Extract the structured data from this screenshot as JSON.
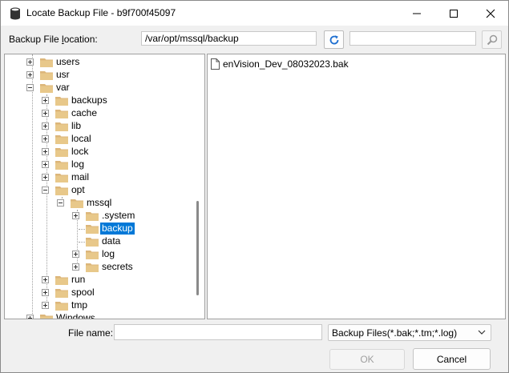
{
  "window": {
    "title": "Locate Backup File - b9f700f45097",
    "minimize_icon": "minimize-icon",
    "maximize_icon": "maximize-icon",
    "close_icon": "close-icon"
  },
  "location": {
    "label_pre": "Backup File ",
    "label_u": "l",
    "label_post": "ocation:",
    "path_value": "/var/opt/mssql/backup",
    "search_value": "",
    "refresh_icon": "refresh-icon",
    "search_icon": "search-icon"
  },
  "tree": {
    "items": [
      {
        "label": "users",
        "expander": "plus"
      },
      {
        "label": "usr",
        "expander": "plus"
      },
      {
        "label": "var",
        "expander": "minus"
      },
      {
        "label": "backups",
        "expander": "plus"
      },
      {
        "label": "cache",
        "expander": "plus"
      },
      {
        "label": "lib",
        "expander": "plus"
      },
      {
        "label": "local",
        "expander": "plus"
      },
      {
        "label": "lock",
        "expander": "plus"
      },
      {
        "label": "log",
        "expander": "plus"
      },
      {
        "label": "mail",
        "expander": "plus"
      },
      {
        "label": "opt",
        "expander": "minus"
      },
      {
        "label": "mssql",
        "expander": "minus"
      },
      {
        "label": ".system",
        "expander": "plus"
      },
      {
        "label": "backup",
        "expander": "none",
        "selected": true
      },
      {
        "label": "data",
        "expander": "none"
      },
      {
        "label": "log",
        "expander": "plus"
      },
      {
        "label": "secrets",
        "expander": "plus"
      },
      {
        "label": "run",
        "expander": "plus"
      },
      {
        "label": "spool",
        "expander": "plus"
      },
      {
        "label": "tmp",
        "expander": "plus"
      },
      {
        "label": "Windows",
        "expander": "plus"
      }
    ]
  },
  "files": {
    "items": [
      {
        "name": "enVision_Dev_08032023.bak",
        "icon": "file-icon"
      }
    ]
  },
  "footer": {
    "filename_label": "File name:",
    "filename_value": "",
    "file_type": "Backup Files(*.bak;*.tm;*.log)",
    "ok_label": "OK",
    "cancel_label": "Cancel"
  },
  "colors": {
    "selection": "#0078d7",
    "folder": "#dcb67a",
    "refresh_accent": "#1e6fd0"
  }
}
